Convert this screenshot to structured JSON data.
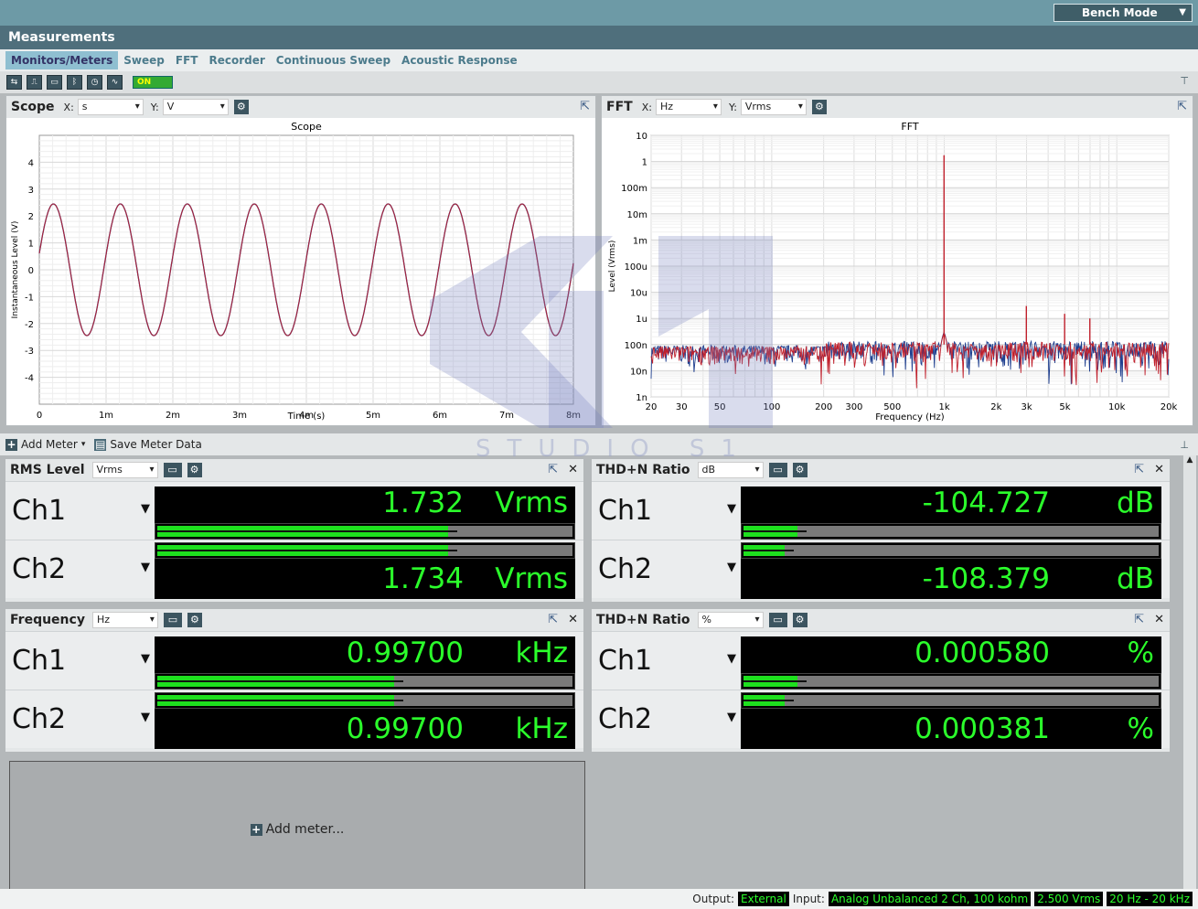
{
  "bench_mode": "Bench Mode",
  "header_title": "Measurements",
  "tabs": [
    "Monitors/Meters",
    "Sweep",
    "FFT",
    "Recorder",
    "Continuous Sweep",
    "Acoustic Response"
  ],
  "toolbar_on": "ON",
  "scope": {
    "title": "Scope",
    "x_label": "X:",
    "x_unit": "s",
    "y_label": "Y:",
    "y_unit": "V",
    "chart_data": {
      "type": "line",
      "title": "Scope",
      "xlabel": "Time (s)",
      "ylabel": "Instantaneous Level (V)",
      "xlim": [
        0,
        0.008
      ],
      "ylim": [
        -5,
        5
      ],
      "xticks": [
        "0",
        "1m",
        "2m",
        "3m",
        "4m",
        "5m",
        "6m",
        "7m",
        "8m"
      ],
      "yticks": [
        "4",
        "3",
        "2",
        "1",
        "0",
        "-1",
        "-2",
        "-3",
        "-4"
      ],
      "series": [
        {
          "frequency_hz": 997,
          "amplitude_v": 2.45
        }
      ]
    }
  },
  "fft": {
    "title": "FFT",
    "x_label": "X:",
    "x_unit": "Hz",
    "y_label": "Y:",
    "y_unit": "Vrms",
    "chart_data": {
      "type": "line",
      "title": "FFT",
      "xlabel": "Frequency (Hz)",
      "ylabel": "Level (Vrms)",
      "xlim": [
        20,
        20000
      ],
      "ylim": [
        1e-09,
        10
      ],
      "xscale": "log",
      "yscale": "log",
      "xticks": [
        "20",
        "30",
        "50",
        "100",
        "200",
        "300",
        "500",
        "1k",
        "2k",
        "3k",
        "5k",
        "10k",
        "20k"
      ],
      "yticks": [
        "10",
        "1",
        "100m",
        "10m",
        "1m",
        "100u",
        "10u",
        "1u",
        "100n",
        "10n",
        "1n"
      ],
      "peaks": [
        {
          "x": 997,
          "y": 1.73
        },
        {
          "x": 2991,
          "y": 3e-06
        },
        {
          "x": 4985,
          "y": 1.5e-06
        },
        {
          "x": 6979,
          "y": 1e-06
        }
      ]
    }
  },
  "meter_bar": {
    "add_meter": "Add Meter",
    "save_meter_data": "Save Meter Data"
  },
  "meters": [
    {
      "title": "RMS Level",
      "unit_select": "Vrms",
      "ch1_label": "Ch1",
      "ch2_label": "Ch2",
      "ch1_value": "1.732",
      "ch1_unit": "Vrms",
      "ch2_value": "1.734",
      "ch2_unit": "Vrms",
      "ch1_level": 0.7,
      "ch2_level": 0.7
    },
    {
      "title": "THD+N Ratio",
      "unit_select": "dB",
      "ch1_label": "Ch1",
      "ch2_label": "Ch2",
      "ch1_value": "-104.727",
      "ch1_unit": "dB",
      "ch2_value": "-108.379",
      "ch2_unit": "dB",
      "ch1_level": 0.13,
      "ch2_level": 0.1
    },
    {
      "title": "Frequency",
      "unit_select": "Hz",
      "ch1_label": "Ch1",
      "ch2_label": "Ch2",
      "ch1_value": "0.99700",
      "ch1_unit": "kHz",
      "ch2_value": "0.99700",
      "ch2_unit": "kHz",
      "ch1_level": 0.57,
      "ch2_level": 0.57
    },
    {
      "title": "THD+N Ratio",
      "unit_select": "%",
      "ch1_label": "Ch1",
      "ch2_label": "Ch2",
      "ch1_value": "0.000580",
      "ch1_unit": "%",
      "ch2_value": "0.000381",
      "ch2_unit": "%",
      "ch1_level": 0.13,
      "ch2_level": 0.1
    }
  ],
  "add_meter_box": "Add meter...",
  "watermark": "STUDIO S1",
  "status": {
    "output_label": "Output:",
    "output": "External",
    "input_label": "Input:",
    "input": "Analog Unbalanced 2 Ch, 100 kohm",
    "level": "2.500 Vrms",
    "bandwidth": "20 Hz - 20 kHz"
  },
  "colors": {
    "ch1": "#1f3f8f",
    "ch2": "#c0202c",
    "meter_text": "#2bff2b",
    "meter_bar": "#1ee01e"
  }
}
